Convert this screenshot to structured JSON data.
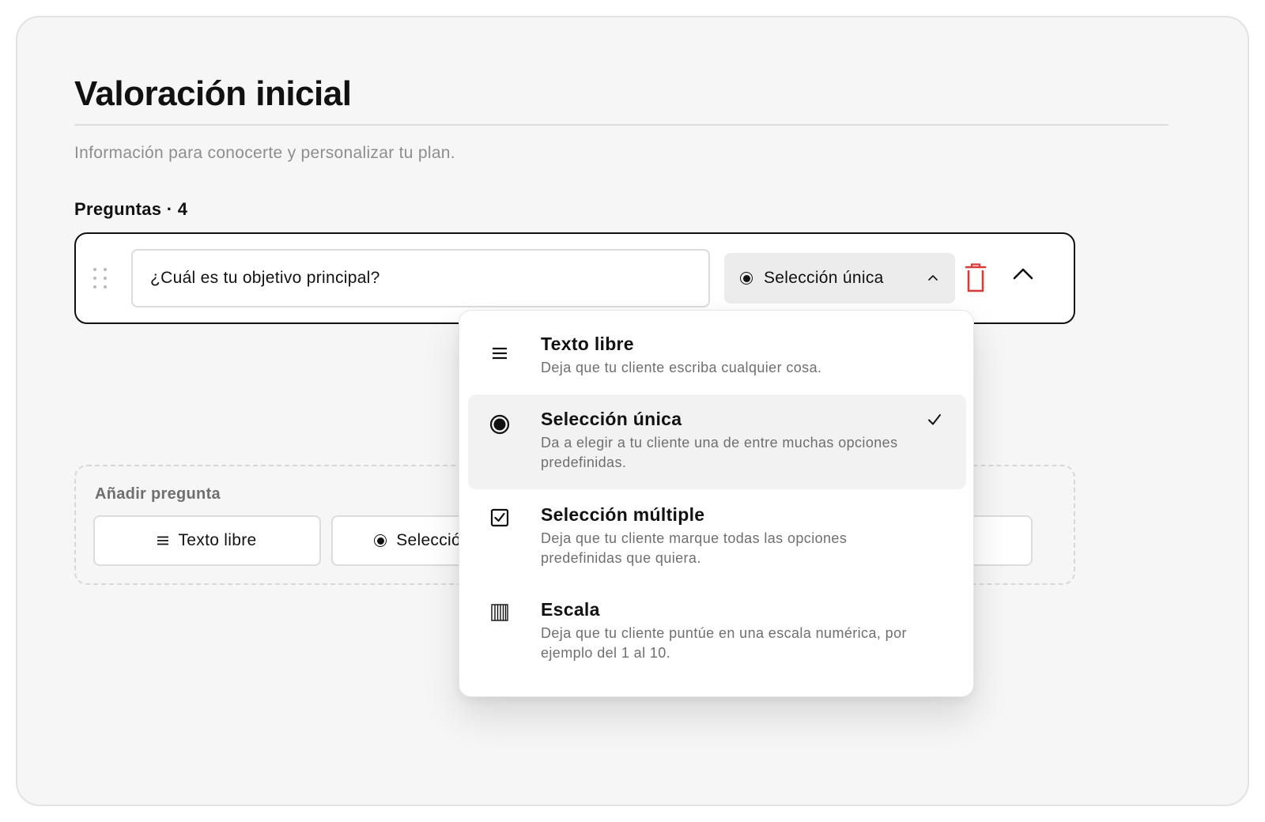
{
  "page": {
    "title": "Valoración inicial",
    "subtitle": "Información para conocerte y personalizar tu plan."
  },
  "questions": {
    "heading": "Preguntas · 4",
    "current": {
      "text": "¿Cuál es tu objetivo principal?",
      "type_label": "Selección única"
    }
  },
  "type_menu": {
    "options": [
      {
        "title": "Texto libre",
        "description": "Deja que tu cliente escriba cualquier cosa.",
        "icon": "lines-icon",
        "selected": false
      },
      {
        "title": "Selección única",
        "description": "Da a elegir a tu cliente una de entre muchas opciones predefinidas.",
        "icon": "radio-icon",
        "selected": true
      },
      {
        "title": "Selección múltiple",
        "description": "Deja que tu cliente marque todas las opciones predefinidas que quiera.",
        "icon": "checkbox-icon",
        "selected": false
      },
      {
        "title": "Escala",
        "description": "Deja que tu cliente puntúe en una escala numérica, por ejemplo del 1 al 10.",
        "icon": "scale-icon",
        "selected": false
      }
    ]
  },
  "add_question": {
    "label": "Añadir pregunta",
    "buttons": [
      {
        "label": "Texto libre",
        "icon": "lines-icon"
      },
      {
        "label": "Selección única",
        "icon": "radio-icon"
      }
    ]
  },
  "colors": {
    "danger": "#d93b3b",
    "text": "#111111",
    "muted": "#8e8e8e",
    "panel_bg": "#f6f6f6"
  }
}
